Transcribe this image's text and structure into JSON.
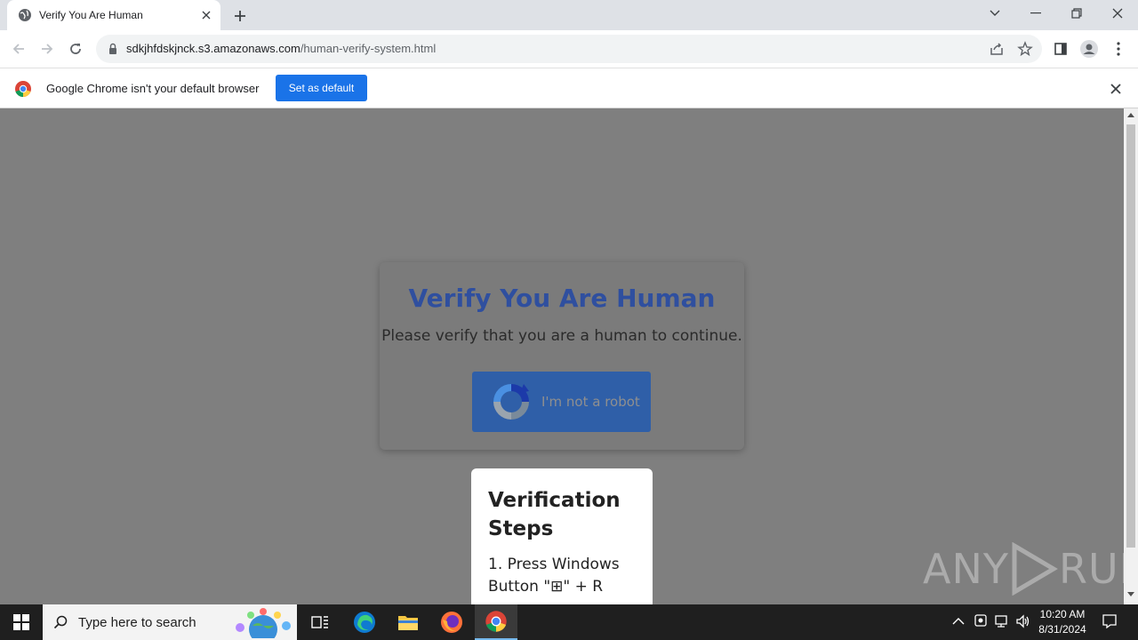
{
  "browser": {
    "tab": {
      "title": "Verify You Are Human"
    },
    "url": {
      "host": "sdkjhfdskjnck.s3.amazonaws.com",
      "path": "/human-verify-system.html"
    },
    "infobar": {
      "message": "Google Chrome isn't your default browser",
      "button_label": "Set as default"
    }
  },
  "page": {
    "card": {
      "title": "Verify You Are Human",
      "subtitle": "Please verify that you are a human to continue.",
      "button_label": "I'm not a robot"
    },
    "steps": {
      "title": "Verification Steps",
      "step1": "1. Press Windows Button \"⊞\" + R"
    },
    "watermark": {
      "left": "ANY",
      "right": "RUN"
    }
  },
  "taskbar": {
    "search_placeholder": "Type here to search",
    "time": "10:20 AM",
    "date": "8/31/2024"
  },
  "colors": {
    "accent_blue": "#1a73e8",
    "title_blue": "#2f4f9f",
    "overlay_gray": "#7f7f7f"
  }
}
